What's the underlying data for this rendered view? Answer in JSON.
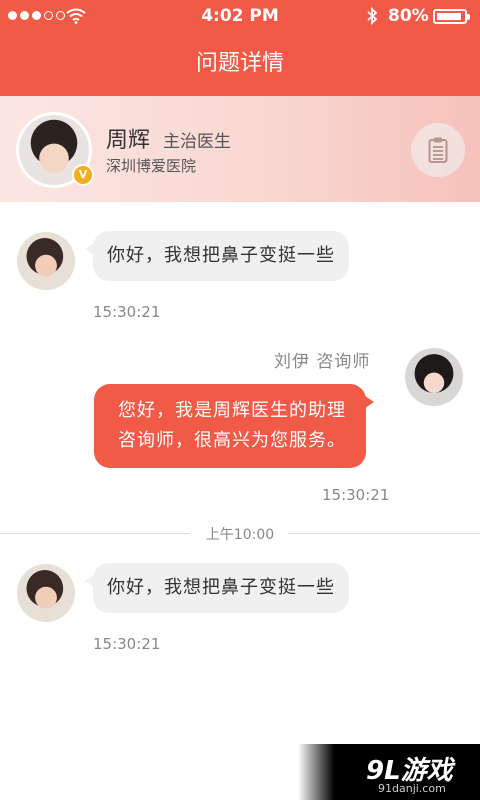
{
  "status_bar": {
    "time": "4:02 PM",
    "battery": "80%",
    "battery_level": 0.8,
    "signal_bars": 3
  },
  "nav": {
    "title": "问题详情"
  },
  "doctor": {
    "name": "周辉",
    "title": "主治医生",
    "hospital": "深圳博爱医院",
    "badge": "V"
  },
  "messages": [
    {
      "side": "left",
      "text": "你好，我想把鼻子变挺一些",
      "time": "15:30:21"
    },
    {
      "side": "right",
      "sender": "刘伊  咨询师",
      "line1": "您好，我是周辉医生的助理",
      "line2": "咨询师，很高兴为您服务。",
      "time": "15:30:21"
    },
    {
      "side": "left",
      "text": "你好，我想把鼻子变挺一些",
      "time": "15:30:21"
    }
  ],
  "divider": {
    "text": "上午10:00"
  },
  "watermark": {
    "main": "9L游戏",
    "sub": "91danji.com"
  },
  "colors": {
    "accent": "#f05a47",
    "bubble_gray": "#f0f0f0",
    "badge": "#f2ae1c"
  }
}
